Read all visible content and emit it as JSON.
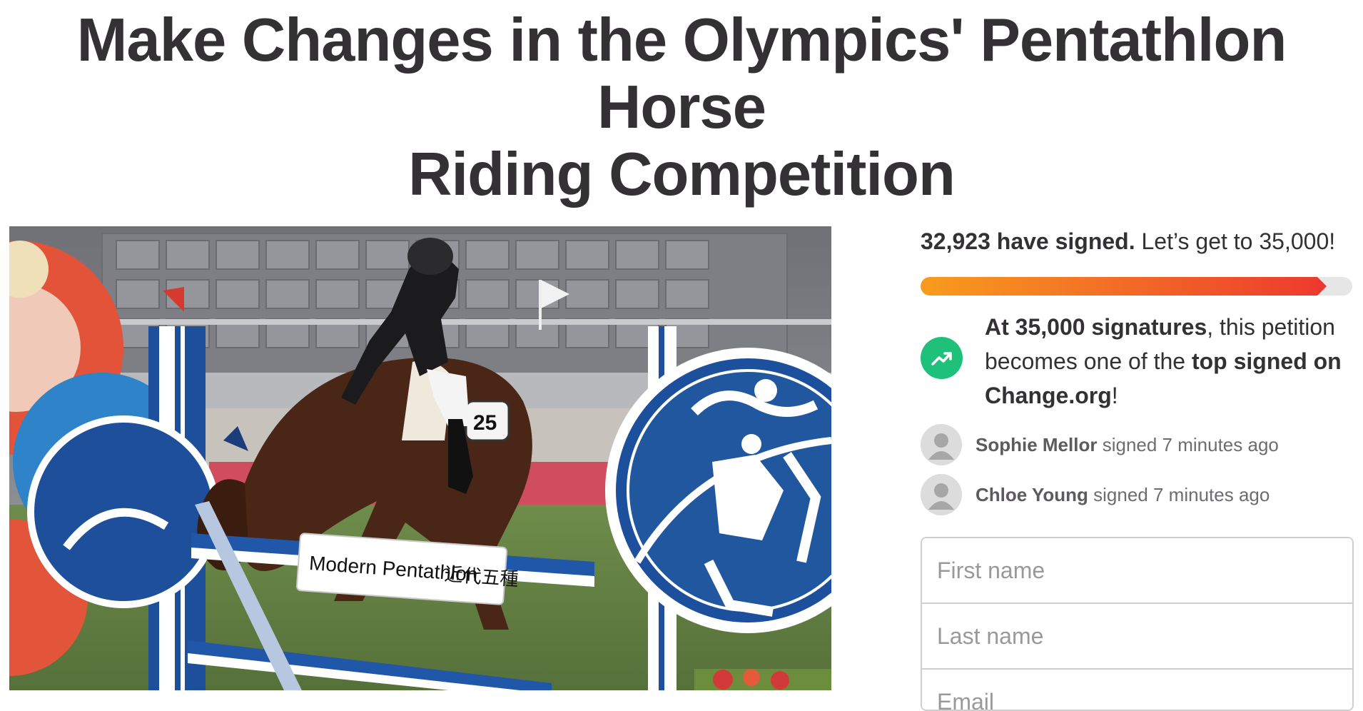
{
  "petition": {
    "title_line1": "Make Changes in the Olympics' Pentathlon Horse",
    "title_line2": "Riding Competition"
  },
  "photo": {
    "banner_text": "Modern Pentathlon",
    "banner_cjk": "近代五種",
    "bib_number": "25"
  },
  "signatures": {
    "count_text": "32,923 have signed.",
    "goal_text": "Let’s get to 35,000!",
    "progress_fraction": 0.94,
    "colors": {
      "start": "#f89c1c",
      "end": "#ed3b2d",
      "track": "#e6e6e6"
    }
  },
  "milestone": {
    "icon": "trending-up-icon",
    "icon_color": "#1ec07a",
    "bold1": "At 35,000 signatures",
    "text1": ", this petition becomes one of the ",
    "bold2": "top signed on Change.org",
    "text2": "!"
  },
  "recent_signers": [
    {
      "name": "Sophie Mellor",
      "action": "signed 7 minutes ago"
    },
    {
      "name": "Chloe Young",
      "action": "signed 7 minutes ago"
    }
  ],
  "form": {
    "first_name_placeholder": "First name",
    "last_name_placeholder": "Last name",
    "email_placeholder": "Email"
  }
}
